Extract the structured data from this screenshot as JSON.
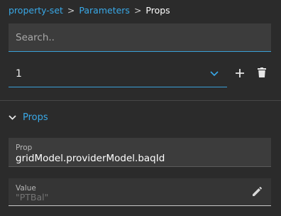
{
  "breadcrumb": {
    "items": [
      "property-set",
      "Parameters"
    ],
    "separator": ">",
    "current": "Props"
  },
  "search": {
    "placeholder": "Search.."
  },
  "selector": {
    "value": "1"
  },
  "section": {
    "title": "Props",
    "expanded": true
  },
  "prop_field": {
    "label": "Prop",
    "value": "gridModel.providerModel.baqId"
  },
  "value_field": {
    "label": "Value",
    "placeholder": "\"PTBal\""
  },
  "icons": {
    "chevron": "chevron-down-icon",
    "add": "plus-icon",
    "delete": "trash-icon",
    "section": "chevron-down-icon",
    "edit": "pencil-icon"
  },
  "colors": {
    "accent": "#39a9e8",
    "background": "#2b2b2b",
    "field": "#3c3c3c"
  }
}
